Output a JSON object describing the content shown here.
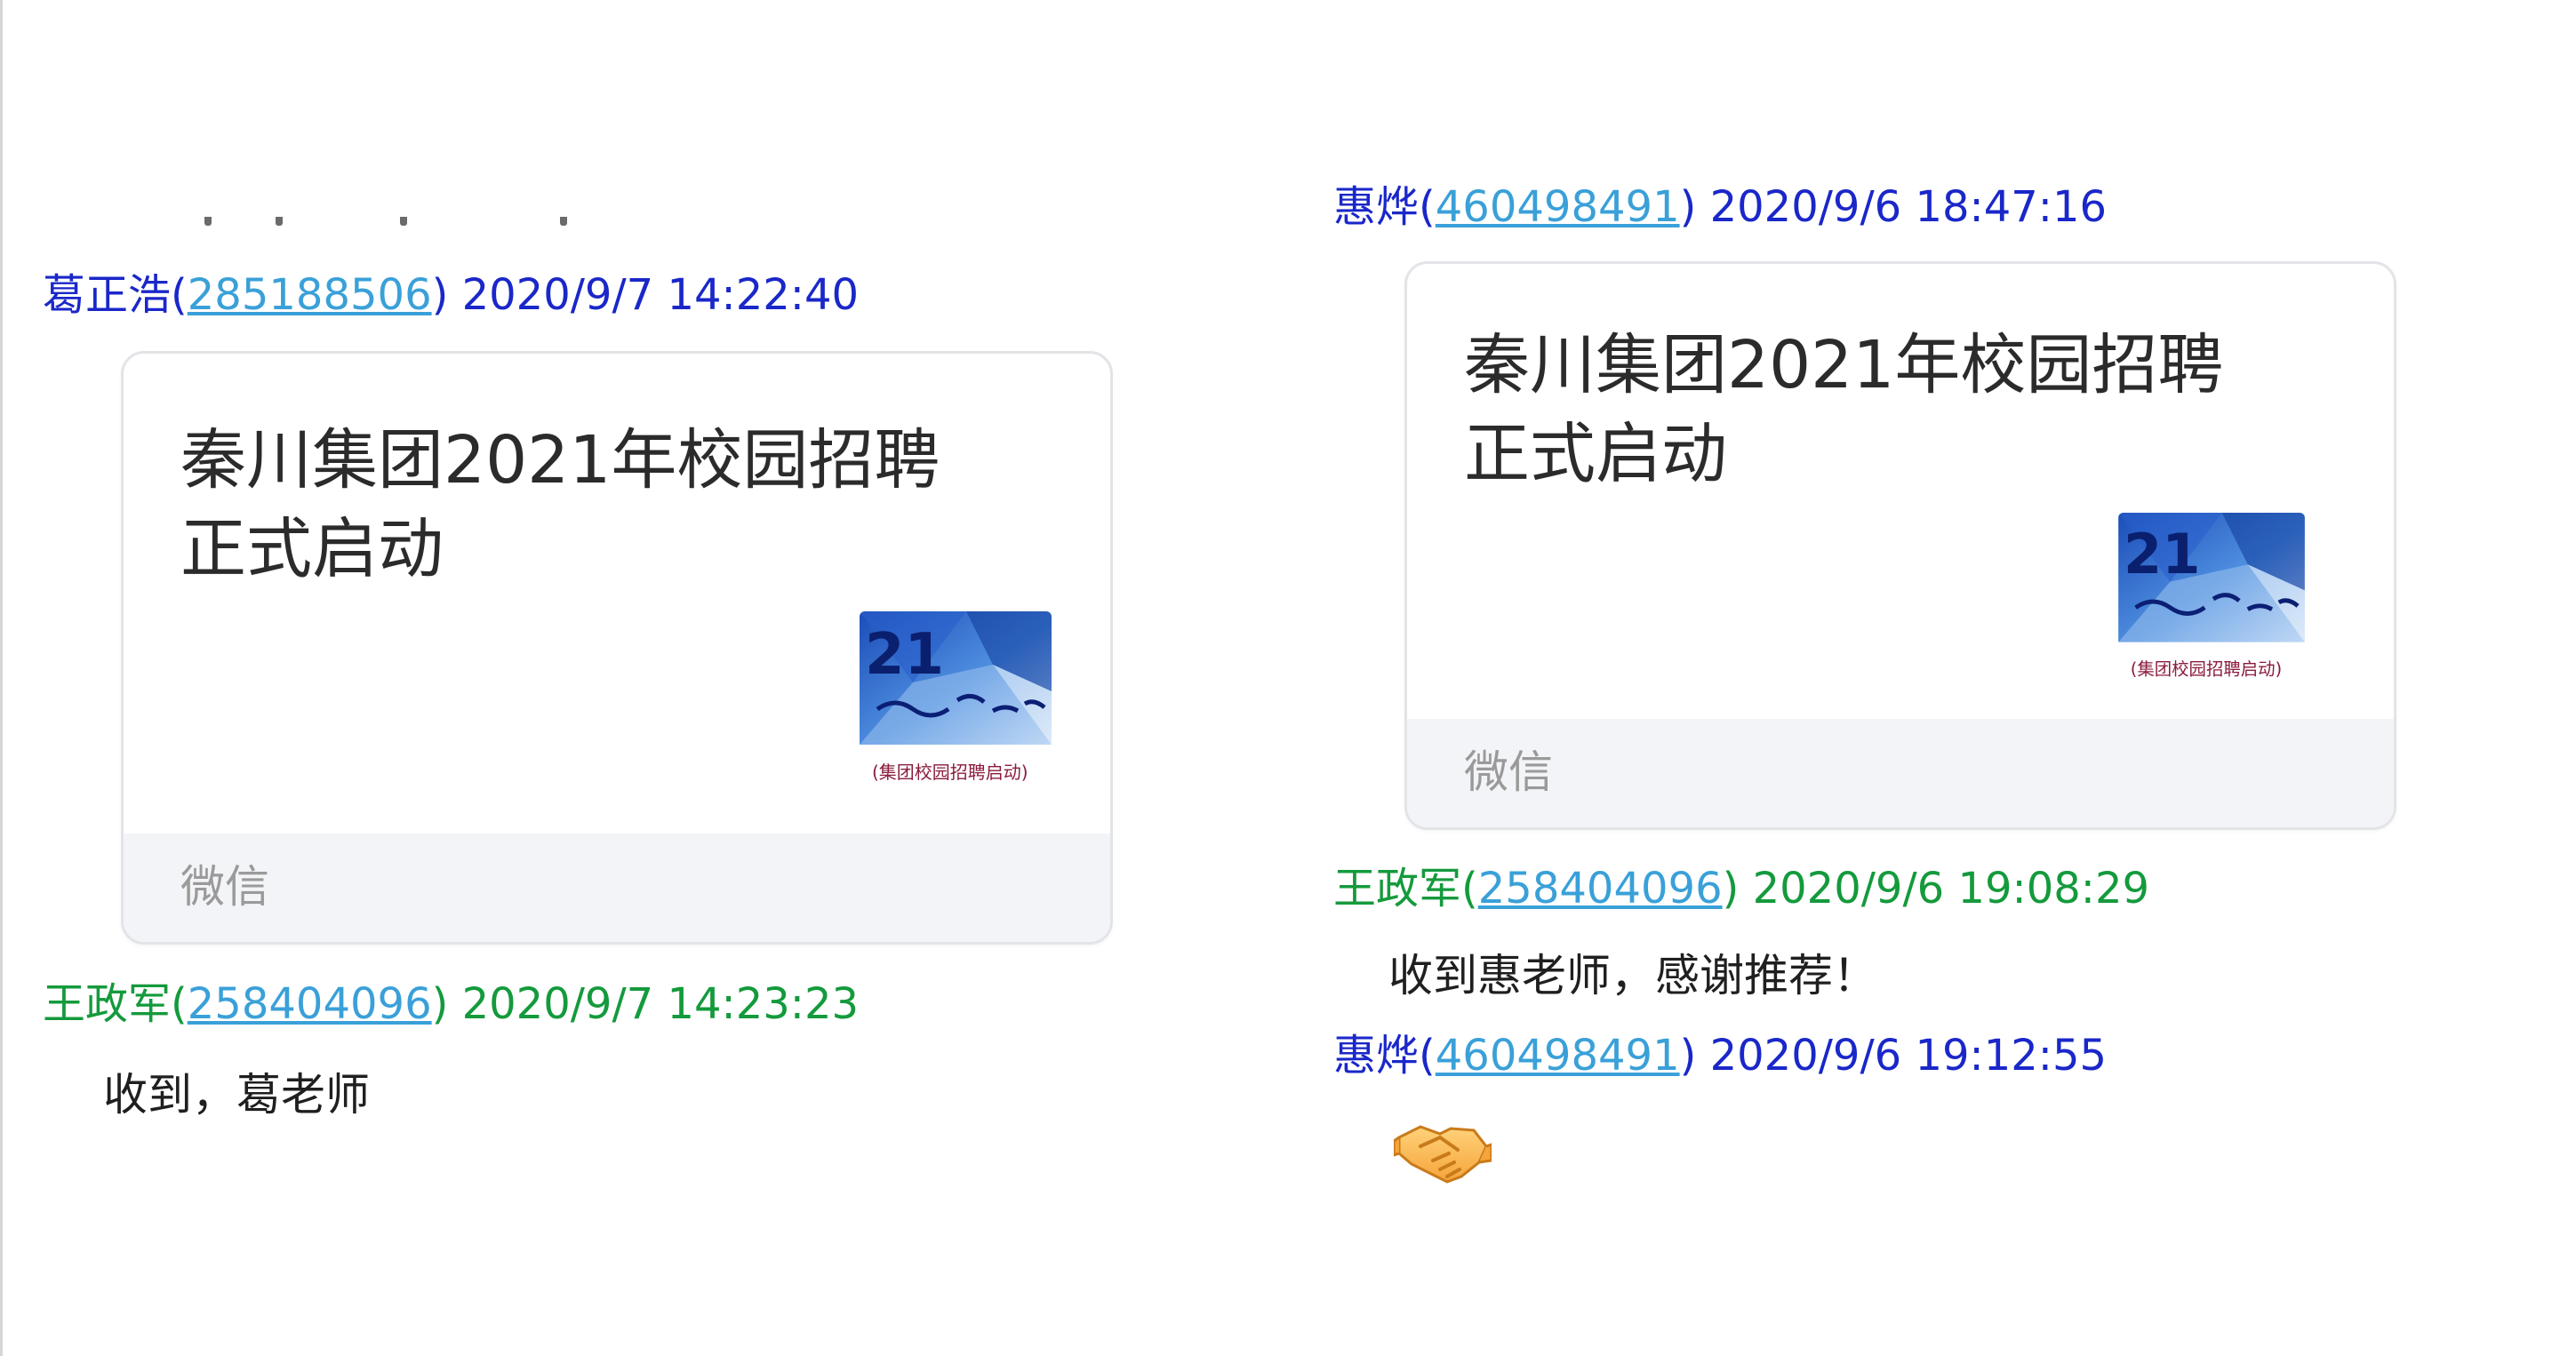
{
  "colors": {
    "sender_blue": "#1a27c9",
    "sender_green": "#149a3c",
    "link_blue": "#3aa0d8",
    "card_border": "#e3e4e8",
    "card_footer_bg": "#f3f4f7",
    "footer_text": "#9a9a9a"
  },
  "left_chat": {
    "msg1": {
      "sender_name": "葛正浩",
      "qq_open": "(",
      "qq": "285188506",
      "qq_close": ")",
      "time": " 2020/9/7 14:22:40",
      "card_title": "秦川集团2021年校园招聘正式启动",
      "card_source": "微信"
    },
    "msg2": {
      "sender_name": "王政军",
      "qq_open": "(",
      "qq": "258404096",
      "qq_close": ")",
      "time": " 2020/9/7 14:23:23",
      "text": "收到，葛老师"
    }
  },
  "right_chat": {
    "msg1": {
      "sender_name": "惠烨",
      "qq_open": "(",
      "qq": "460498491",
      "qq_close": ")",
      "time": " 2020/9/6 18:47:16",
      "card_title": "秦川集团2021年校园招聘正式启动",
      "card_source": "微信"
    },
    "msg2": {
      "sender_name": "王政军",
      "qq_open": "(",
      "qq": "258404096",
      "qq_close": ")",
      "time": " 2020/9/6 19:08:29",
      "text": "收到惠老师，感谢推荐！"
    },
    "msg3": {
      "sender_name": "惠烨",
      "qq_open": "(",
      "qq": "460498491",
      "qq_close": ")",
      "time": " 2020/9/6 19:12:55",
      "emoji": "handshake-emoji"
    }
  },
  "thumb": {
    "number": "21",
    "caption": "(集团校园招聘启动)",
    "icon": "campus-recruit-thumbnail"
  }
}
